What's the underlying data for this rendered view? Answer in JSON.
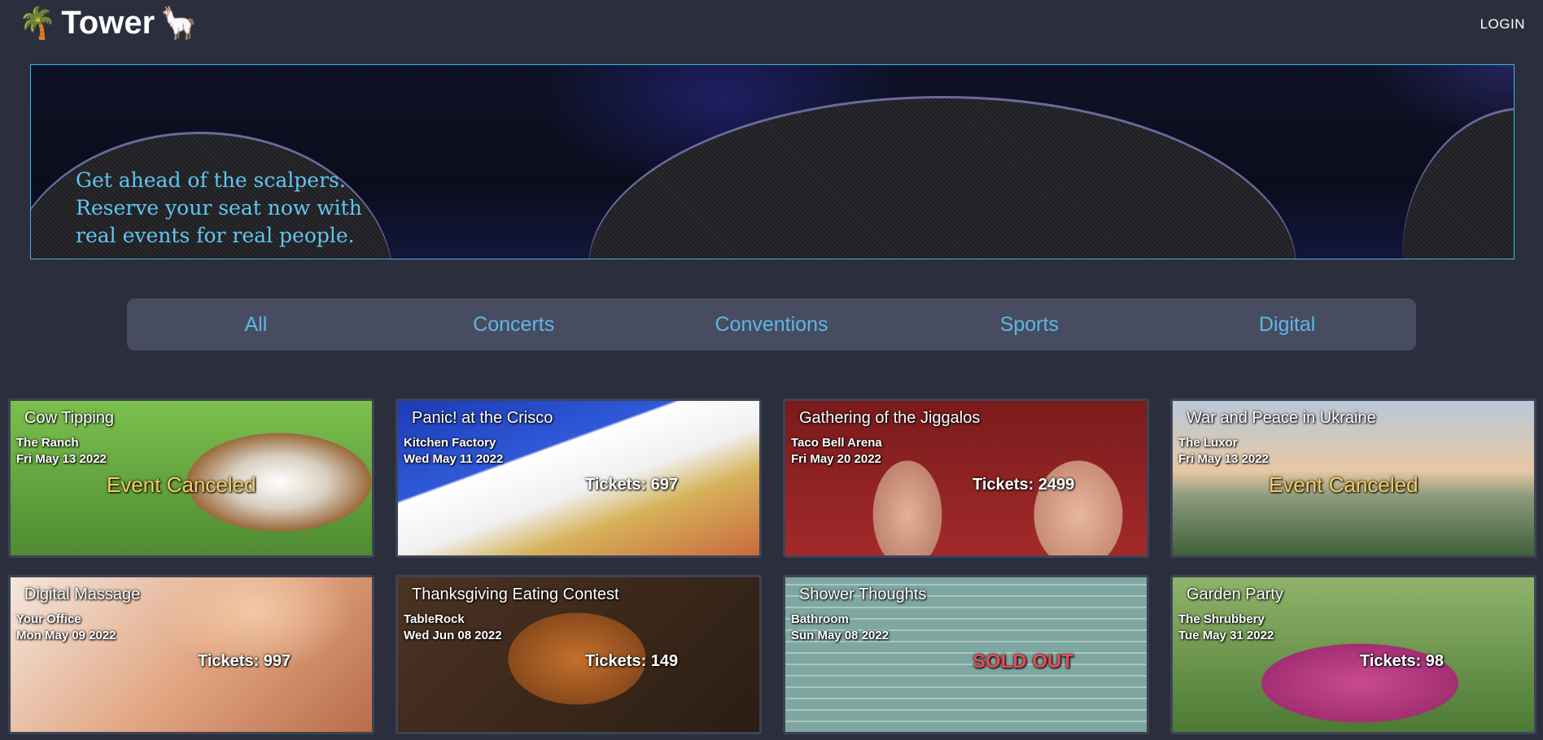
{
  "nav": {
    "brand": "Tower",
    "login": "LOGIN"
  },
  "hero": {
    "lines": [
      "Get ahead of the scalpers.",
      "Reserve your seat now with",
      "real events for real people."
    ]
  },
  "categories": [
    "All",
    "Concerts",
    "Conventions",
    "Sports",
    "Digital"
  ],
  "events": [
    {
      "name": "Cow Tipping",
      "location": "The Ranch",
      "date": "Fri May 13 2022",
      "status": "Event Canceled"
    },
    {
      "name": "Panic! at the Crisco",
      "location": "Kitchen Factory",
      "date": "Wed May 11 2022",
      "status": "Tickets: 697"
    },
    {
      "name": "Gathering of the Jiggalos",
      "location": "Taco Bell Arena",
      "date": "Fri May 20 2022",
      "status": "Tickets: 2499"
    },
    {
      "name": "War and Peace in Ukraine",
      "location": "The Luxor",
      "date": "Fri May 13 2022",
      "status": "Event Canceled"
    },
    {
      "name": "Digital Massage",
      "location": "Your Office",
      "date": "Mon May 09 2022",
      "status": "Tickets: 997"
    },
    {
      "name": "Thanksgiving Eating Contest",
      "location": "TableRock",
      "date": "Wed Jun 08 2022",
      "status": "Tickets: 149"
    },
    {
      "name": "Shower Thoughts",
      "location": "Bathroom",
      "date": "Sun May 08 2022",
      "status": "SOLD OUT"
    },
    {
      "name": "Garden Party",
      "location": "The Shrubbery",
      "date": "Tue May 31 2022",
      "status": "Tickets: 98"
    }
  ]
}
